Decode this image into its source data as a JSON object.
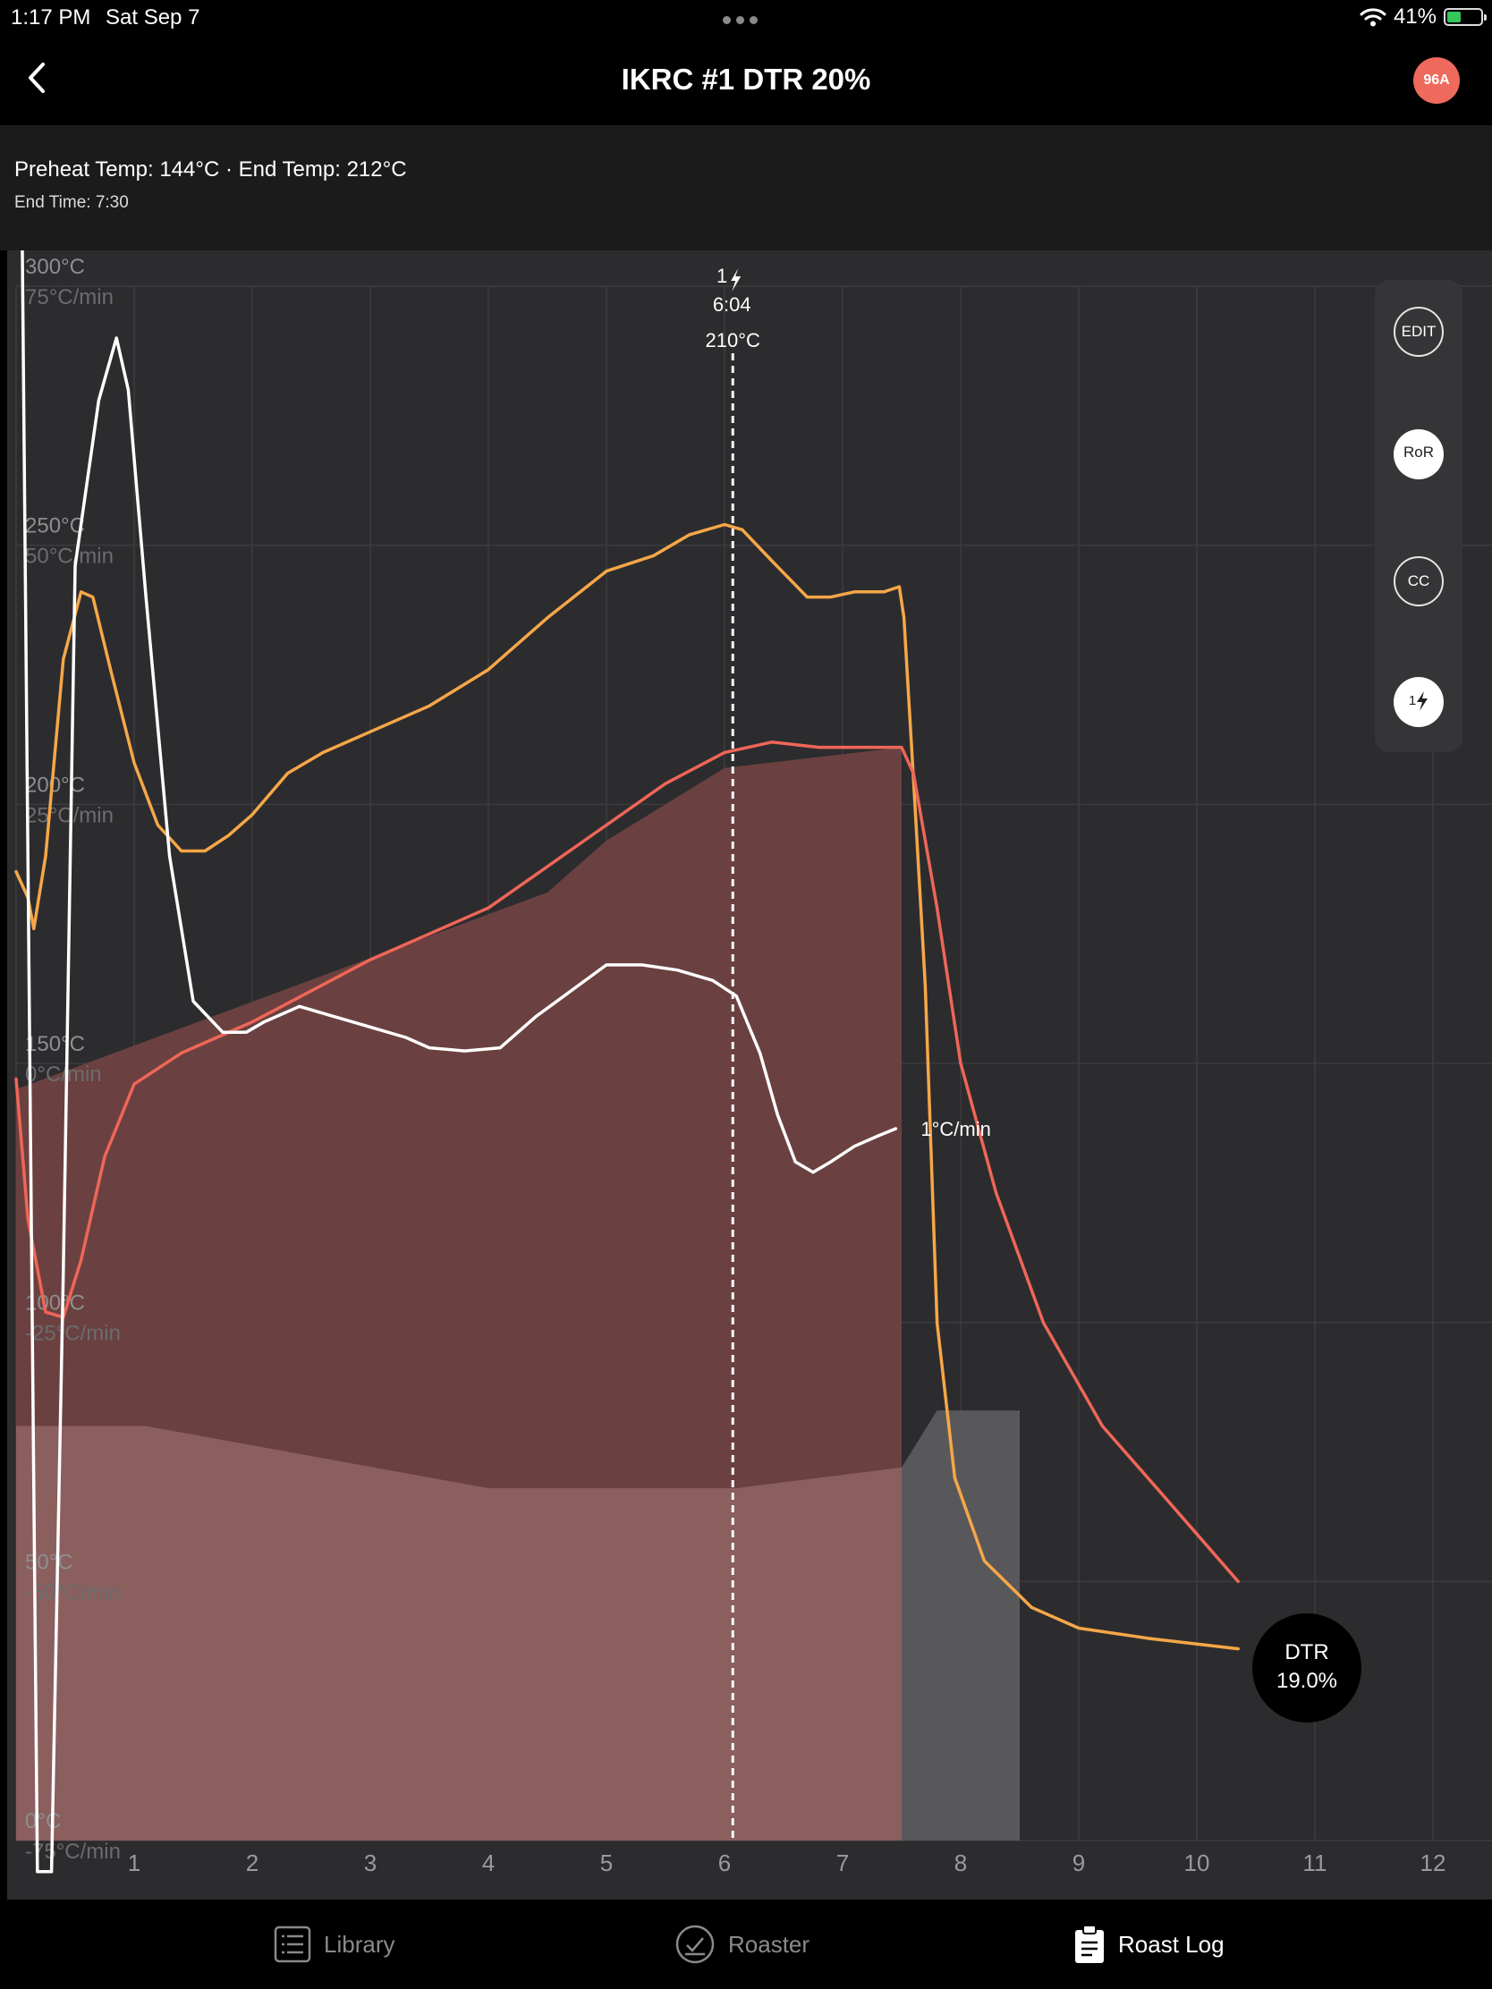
{
  "status_bar": {
    "time": "1:17 PM",
    "date": "Sat Sep 7",
    "battery": "41%",
    "battery_level": 0.41
  },
  "nav": {
    "title": "IKRC #1 DTR 20%",
    "badge": "96A",
    "badge_color": "#ee6a5d"
  },
  "info": {
    "line1": "Preheat Temp: 144°C · End Temp: 212°C",
    "line2": "End Time: 7:30"
  },
  "toolbar": {
    "edit": "EDIT",
    "ror": "RoR",
    "cc": "CC",
    "crack": "1"
  },
  "dtr": {
    "label": "DTR",
    "value": "19.0%"
  },
  "tabs": {
    "library": "Library",
    "roaster": "Roaster",
    "roast_log": "Roast Log"
  },
  "chart_data": {
    "type": "line",
    "x_unit": "minutes",
    "xlim": [
      0,
      12.5
    ],
    "ylim": [
      0,
      300
    ],
    "ror_lim": [
      -75,
      75
    ],
    "x_ticks": [
      "1",
      "2",
      "3",
      "4",
      "5",
      "6",
      "7",
      "8",
      "9",
      "10",
      "11",
      "12"
    ],
    "y_ticks": [
      {
        "temp": "300°C",
        "ror": "75°C/min",
        "value": 300
      },
      {
        "temp": "250°C",
        "ror": "50°C/min",
        "value": 250
      },
      {
        "temp": "200°C",
        "ror": "25°C/min",
        "value": 200
      },
      {
        "temp": "150°C",
        "ror": "0°C/min",
        "value": 150
      },
      {
        "temp": "100°C",
        "ror": "-25°C/min",
        "value": 100
      },
      {
        "temp": "50°C",
        "ror": "-50°C/min",
        "value": 50
      },
      {
        "temp": "0°C",
        "ror": "-75°C/min",
        "value": 0
      }
    ],
    "first_crack": {
      "label": "1",
      "time": "6:04",
      "temp": "210°C",
      "x": 6.07
    },
    "ror_end_label": "1°C/min",
    "colors": {
      "background": "#2c2c2e",
      "grid": "#3c3c3f",
      "orange": "#f6a748",
      "red": "#ef6658",
      "ror": "#ffffff",
      "power_fill": "#6a4140",
      "fan_fill": "#8a5f5e",
      "cooling_fill": "#58585a"
    },
    "series": [
      {
        "color": "orange",
        "points": [
          [
            0,
            187
          ],
          [
            0.1,
            182
          ],
          [
            0.15,
            176
          ],
          [
            0.25,
            190
          ],
          [
            0.4,
            228
          ],
          [
            0.55,
            241
          ],
          [
            0.65,
            240
          ],
          [
            0.8,
            226
          ],
          [
            1.0,
            208
          ],
          [
            1.2,
            196
          ],
          [
            1.4,
            191
          ],
          [
            1.6,
            191
          ],
          [
            1.8,
            194
          ],
          [
            2.0,
            198
          ],
          [
            2.3,
            206
          ],
          [
            2.6,
            210
          ],
          [
            3.0,
            214
          ],
          [
            3.5,
            219
          ],
          [
            4.0,
            226
          ],
          [
            4.5,
            236
          ],
          [
            5.0,
            245
          ],
          [
            5.4,
            248
          ],
          [
            5.7,
            252
          ],
          [
            6.0,
            254
          ],
          [
            6.15,
            253
          ],
          [
            6.4,
            247
          ],
          [
            6.7,
            240
          ],
          [
            6.9,
            240
          ],
          [
            7.1,
            241
          ],
          [
            7.35,
            241
          ],
          [
            7.48,
            242
          ],
          [
            7.52,
            236
          ],
          [
            7.6,
            205
          ],
          [
            7.7,
            165
          ],
          [
            7.8,
            100
          ],
          [
            7.95,
            70
          ],
          [
            8.2,
            54
          ],
          [
            8.6,
            45
          ],
          [
            9.0,
            41
          ],
          [
            9.6,
            39
          ],
          [
            10.35,
            37
          ]
        ]
      },
      {
        "color": "red",
        "points": [
          [
            0,
            147
          ],
          [
            0.1,
            120
          ],
          [
            0.25,
            102
          ],
          [
            0.4,
            101
          ],
          [
            0.55,
            112
          ],
          [
            0.75,
            132
          ],
          [
            1.0,
            146
          ],
          [
            1.4,
            152
          ],
          [
            2.0,
            158
          ],
          [
            2.5,
            164
          ],
          [
            3.0,
            170
          ],
          [
            3.5,
            175
          ],
          [
            4.0,
            180
          ],
          [
            4.5,
            188
          ],
          [
            5.0,
            196
          ],
          [
            5.5,
            204
          ],
          [
            6.0,
            210
          ],
          [
            6.4,
            212
          ],
          [
            6.8,
            211
          ],
          [
            7.2,
            211
          ],
          [
            7.5,
            211
          ],
          [
            7.6,
            206
          ],
          [
            7.8,
            180
          ],
          [
            8.0,
            150
          ],
          [
            8.3,
            125
          ],
          [
            8.7,
            100
          ],
          [
            9.2,
            80
          ],
          [
            9.7,
            67
          ],
          [
            10.35,
            50
          ]
        ]
      },
      {
        "color": "ror",
        "points": [
          [
            0,
            144
          ],
          [
            0.1,
            20
          ],
          [
            0.18,
            -78
          ],
          [
            0.3,
            -78
          ],
          [
            0.4,
            -20
          ],
          [
            0.5,
            48
          ],
          [
            0.7,
            64
          ],
          [
            0.85,
            70
          ],
          [
            0.95,
            65
          ],
          [
            1.1,
            45
          ],
          [
            1.3,
            20
          ],
          [
            1.5,
            6
          ],
          [
            1.75,
            3
          ],
          [
            1.95,
            3
          ],
          [
            2.1,
            4
          ],
          [
            2.4,
            5.5
          ],
          [
            2.7,
            4.5
          ],
          [
            3.0,
            3.5
          ],
          [
            3.3,
            2.5
          ],
          [
            3.5,
            1.5
          ],
          [
            3.8,
            1.2
          ],
          [
            4.1,
            1.5
          ],
          [
            4.4,
            4.5
          ],
          [
            4.7,
            7
          ],
          [
            5.0,
            9.5
          ],
          [
            5.3,
            9.5
          ],
          [
            5.6,
            9
          ],
          [
            5.9,
            8
          ],
          [
            6.1,
            6.5
          ],
          [
            6.3,
            1
          ],
          [
            6.45,
            -5
          ],
          [
            6.6,
            -9.5
          ],
          [
            6.75,
            -10.5
          ],
          [
            6.9,
            -9.5
          ],
          [
            7.1,
            -8
          ],
          [
            7.3,
            -7
          ],
          [
            7.45,
            -6.3
          ]
        ]
      }
    ],
    "power_area": [
      [
        0,
        145
      ],
      [
        4.5,
        183
      ],
      [
        5.0,
        193
      ],
      [
        6.0,
        207
      ],
      [
        7.5,
        211
      ]
    ],
    "fan_area": [
      [
        0,
        80
      ],
      [
        1.1,
        80
      ],
      [
        4.0,
        68
      ],
      [
        6.1,
        68
      ],
      [
        7.5,
        72
      ]
    ],
    "cooling_area": [
      [
        7.5,
        72
      ],
      [
        7.8,
        83
      ],
      [
        8.5,
        83
      ]
    ]
  }
}
